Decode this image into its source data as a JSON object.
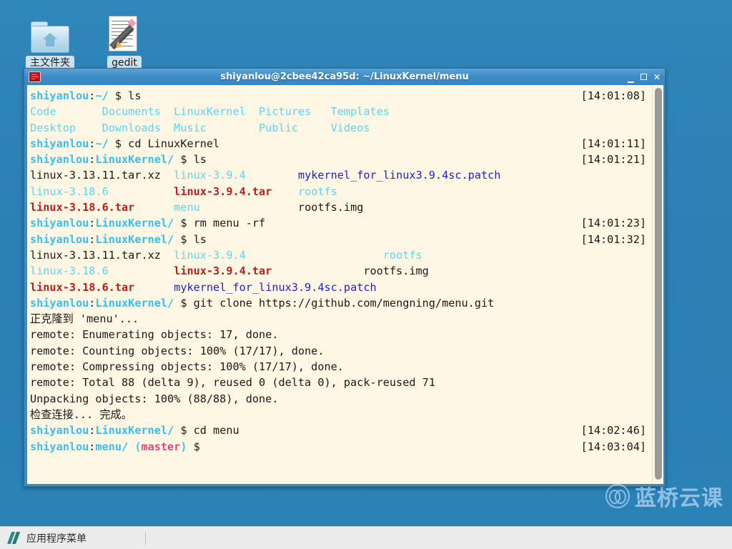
{
  "desktop": {
    "icons": [
      {
        "name": "home-folder",
        "label": "主文件夹",
        "icon": "folder-home-icon"
      },
      {
        "name": "gedit",
        "label": "gedit",
        "icon": "document-pencil-icon"
      }
    ],
    "background_color": "#2b82b7"
  },
  "window": {
    "title": "shiyanlou@2cbee42ca95d: ~/LinuxKernel/menu",
    "icon": "terminal-icon",
    "controls": {
      "minimize": "_",
      "maximize": "□",
      "close": "✕"
    },
    "titlebar_color": "#3e8cc6"
  },
  "terminal": {
    "background_color": "#fdf6e3",
    "foreground_color": "#1a1a1a",
    "prompt_user": "shiyanlou",
    "lines": [
      {
        "id": "l1",
        "segs": [
          {
            "t": "shiyanlou",
            "c": "cyan"
          },
          {
            "t": ":",
            "c": "dark"
          },
          {
            "t": "~/",
            "c": "cyan"
          },
          {
            "t": " $ ls",
            "c": "dark"
          }
        ],
        "stamp": "[14:01:08]"
      },
      {
        "id": "l2",
        "segs": [
          {
            "t": "Code       Documents  LinuxKernel  Pictures   Templates",
            "c": "cyan-n"
          }
        ],
        "stamp": ""
      },
      {
        "id": "l3",
        "segs": [
          {
            "t": "Desktop    Downloads  Music        Public     Videos",
            "c": "cyan-n"
          }
        ],
        "stamp": ""
      },
      {
        "id": "l4",
        "segs": [
          {
            "t": "shiyanlou",
            "c": "cyan"
          },
          {
            "t": ":",
            "c": "dark"
          },
          {
            "t": "~/",
            "c": "cyan"
          },
          {
            "t": " $ cd LinuxKernel",
            "c": "dark"
          }
        ],
        "stamp": "[14:01:11]"
      },
      {
        "id": "l5",
        "segs": [
          {
            "t": "shiyanlou",
            "c": "cyan"
          },
          {
            "t": ":",
            "c": "dark"
          },
          {
            "t": "LinuxKernel/",
            "c": "cyan"
          },
          {
            "t": " $ ls",
            "c": "dark"
          }
        ],
        "stamp": "[14:01:21]"
      },
      {
        "id": "l6",
        "segs": [
          {
            "t": "linux-3.13.11.tar.xz  ",
            "c": "dark"
          },
          {
            "t": "linux-3.9.4",
            "c": "cyan-n"
          },
          {
            "t": "        ",
            "c": "dark"
          },
          {
            "t": "mykernel_for_linux3.9.4sc.patch",
            "c": "blue"
          }
        ],
        "stamp": ""
      },
      {
        "id": "l7",
        "segs": [
          {
            "t": "linux-3.18.6",
            "c": "cyan-n"
          },
          {
            "t": "          ",
            "c": "dark"
          },
          {
            "t": "linux-3.9.4.tar",
            "c": "red"
          },
          {
            "t": "    ",
            "c": "dark"
          },
          {
            "t": "rootfs",
            "c": "cyan-n"
          }
        ],
        "stamp": ""
      },
      {
        "id": "l8",
        "segs": [
          {
            "t": "linux-3.18.6.tar",
            "c": "red"
          },
          {
            "t": "      ",
            "c": "dark"
          },
          {
            "t": "menu",
            "c": "cyan-n"
          },
          {
            "t": "               rootfs.img",
            "c": "dark"
          }
        ],
        "stamp": ""
      },
      {
        "id": "l9",
        "segs": [
          {
            "t": "shiyanlou",
            "c": "cyan"
          },
          {
            "t": ":",
            "c": "dark"
          },
          {
            "t": "LinuxKernel/",
            "c": "cyan"
          },
          {
            "t": " $ rm menu -rf",
            "c": "dark"
          }
        ],
        "stamp": "[14:01:23]"
      },
      {
        "id": "l10",
        "segs": [
          {
            "t": "shiyanlou",
            "c": "cyan"
          },
          {
            "t": ":",
            "c": "dark"
          },
          {
            "t": "LinuxKernel/",
            "c": "cyan"
          },
          {
            "t": " $ ls",
            "c": "dark"
          }
        ],
        "stamp": "[14:01:32]"
      },
      {
        "id": "l11",
        "segs": [
          {
            "t": "linux-3.13.11.tar.xz  ",
            "c": "dark"
          },
          {
            "t": "linux-3.9.4",
            "c": "cyan-n"
          },
          {
            "t": "                     ",
            "c": "dark"
          },
          {
            "t": "rootfs",
            "c": "cyan-n"
          }
        ],
        "stamp": ""
      },
      {
        "id": "l12",
        "segs": [
          {
            "t": "linux-3.18.6",
            "c": "cyan-n"
          },
          {
            "t": "          ",
            "c": "dark"
          },
          {
            "t": "linux-3.9.4.tar",
            "c": "red"
          },
          {
            "t": "              rootfs.img",
            "c": "dark"
          }
        ],
        "stamp": ""
      },
      {
        "id": "l13",
        "segs": [
          {
            "t": "linux-3.18.6.tar",
            "c": "red"
          },
          {
            "t": "      ",
            "c": "dark"
          },
          {
            "t": "mykernel_for_linux3.9.4sc.patch",
            "c": "blue"
          }
        ],
        "stamp": ""
      },
      {
        "id": "l14",
        "segs": [
          {
            "t": "shiyanlou",
            "c": "cyan"
          },
          {
            "t": ":",
            "c": "dark"
          },
          {
            "t": "LinuxKernel/",
            "c": "cyan"
          },
          {
            "t": " $ git clone https://github.com/mengning/menu.git",
            "c": "dark"
          }
        ],
        "stamp": ""
      },
      {
        "id": "l15",
        "segs": [
          {
            "t": "正克隆到 'menu'...",
            "c": "dark"
          }
        ],
        "stamp": ""
      },
      {
        "id": "l16",
        "segs": [
          {
            "t": "remote: Enumerating objects: 17, done.",
            "c": "dark"
          }
        ],
        "stamp": ""
      },
      {
        "id": "l17",
        "segs": [
          {
            "t": "remote: Counting objects: 100% (17/17), done.",
            "c": "dark"
          }
        ],
        "stamp": ""
      },
      {
        "id": "l18",
        "segs": [
          {
            "t": "remote: Compressing objects: 100% (17/17), done.",
            "c": "dark"
          }
        ],
        "stamp": ""
      },
      {
        "id": "l19",
        "segs": [
          {
            "t": "remote: Total 88 (delta 9), reused 0 (delta 0), pack-reused 71",
            "c": "dark"
          }
        ],
        "stamp": ""
      },
      {
        "id": "l20",
        "segs": [
          {
            "t": "Unpacking objects: 100% (88/88), done.",
            "c": "dark"
          }
        ],
        "stamp": ""
      },
      {
        "id": "l21",
        "segs": [
          {
            "t": "检查连接... 完成。",
            "c": "dark"
          }
        ],
        "stamp": ""
      },
      {
        "id": "l22",
        "segs": [
          {
            "t": "shiyanlou",
            "c": "cyan"
          },
          {
            "t": ":",
            "c": "dark"
          },
          {
            "t": "LinuxKernel/",
            "c": "cyan"
          },
          {
            "t": " $ cd menu",
            "c": "dark"
          }
        ],
        "stamp": "[14:02:46]"
      },
      {
        "id": "l23",
        "segs": [
          {
            "t": "shiyanlou",
            "c": "cyan"
          },
          {
            "t": ":",
            "c": "dark"
          },
          {
            "t": "menu/",
            "c": "cyan"
          },
          {
            "t": " (",
            "c": "cyan"
          },
          {
            "t": "master",
            "c": "pink"
          },
          {
            "t": ")",
            "c": "cyan"
          },
          {
            "t": " $",
            "c": "dark"
          }
        ],
        "stamp": "[14:03:04]"
      }
    ]
  },
  "watermark": {
    "text": "蓝桥云课",
    "icon": "lanqiao-logo-icon",
    "color": "#cfe6ff"
  },
  "taskbar": {
    "app_menu_label": "应用程序菜单",
    "app_menu_icon": "xfce-mouse-icon",
    "background_color": "#ececec"
  }
}
